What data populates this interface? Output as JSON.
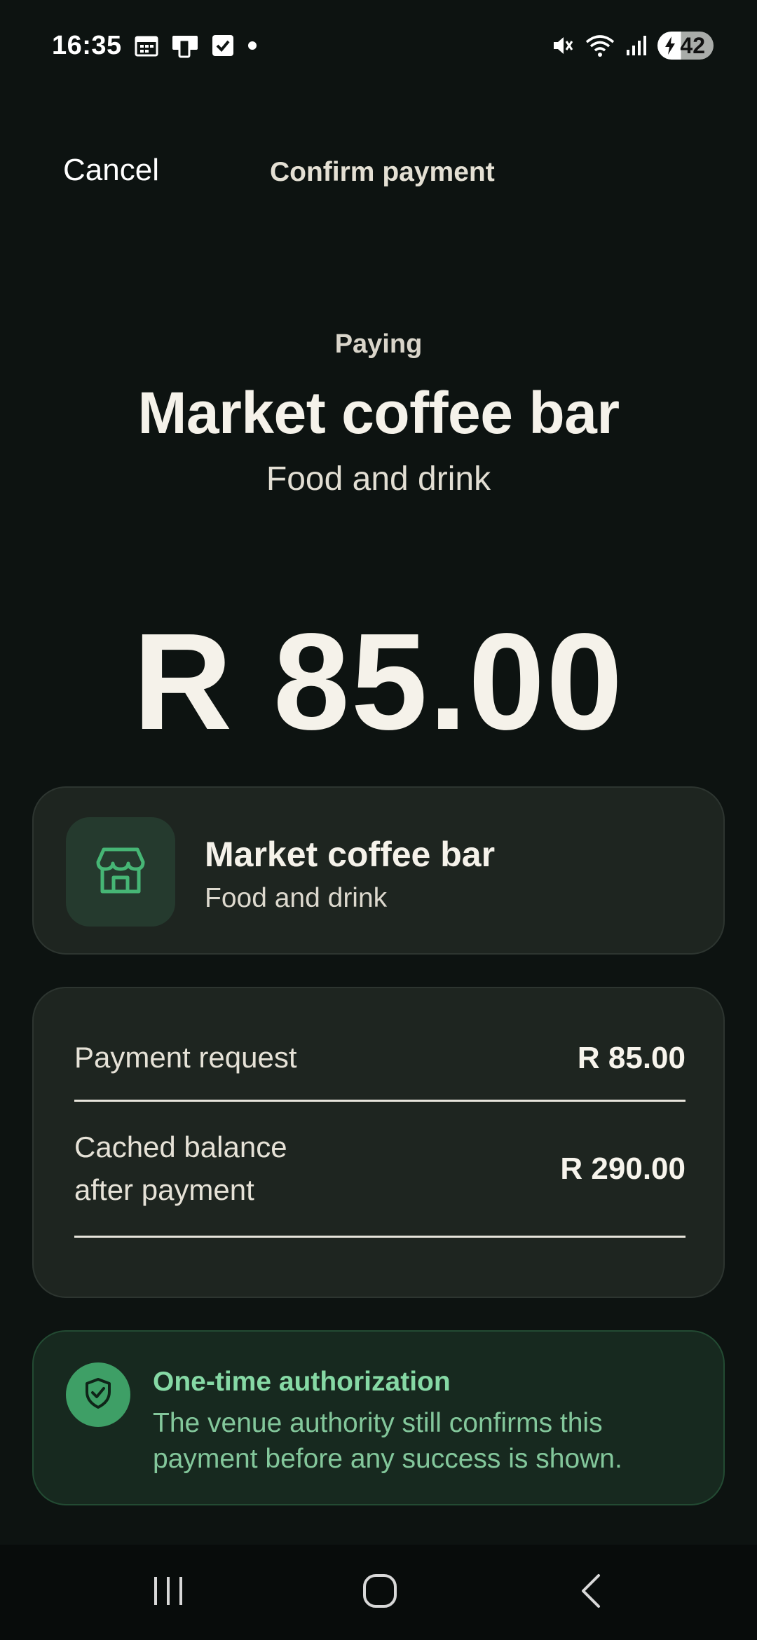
{
  "status_bar": {
    "time": "16:35",
    "battery_level": "42",
    "icons": [
      "calendar-icon",
      "phone-tablet-icon",
      "checkbox-icon",
      "dot-icon",
      "mute-icon",
      "wifi-icon",
      "signal-icon",
      "battery-charging-icon"
    ]
  },
  "header": {
    "cancel_label": "Cancel",
    "title": "Confirm payment"
  },
  "hero": {
    "paying_label": "Paying",
    "merchant_name": "Market coffee bar",
    "merchant_category": "Food and drink",
    "amount": "R 85.00"
  },
  "merchant_card": {
    "icon": "store-icon",
    "name": "Market coffee bar",
    "category": "Food and drink"
  },
  "summary": {
    "rows": [
      {
        "label": "Payment request",
        "value": "R 85.00"
      },
      {
        "label_line1": "Cached balance",
        "label_line2": "after payment",
        "value": "R 290.00"
      }
    ]
  },
  "notice": {
    "icon": "shield-check-icon",
    "title": "One-time authorization",
    "body": "The venue authority still confirms this payment before any success is shown."
  },
  "nav": {
    "items": [
      "recents-icon",
      "home-icon",
      "back-icon"
    ]
  },
  "colors": {
    "background": "#0d1311",
    "card": "#1e2520",
    "accent_green": "#3e9f66",
    "notice_text": "#86d9a5"
  }
}
